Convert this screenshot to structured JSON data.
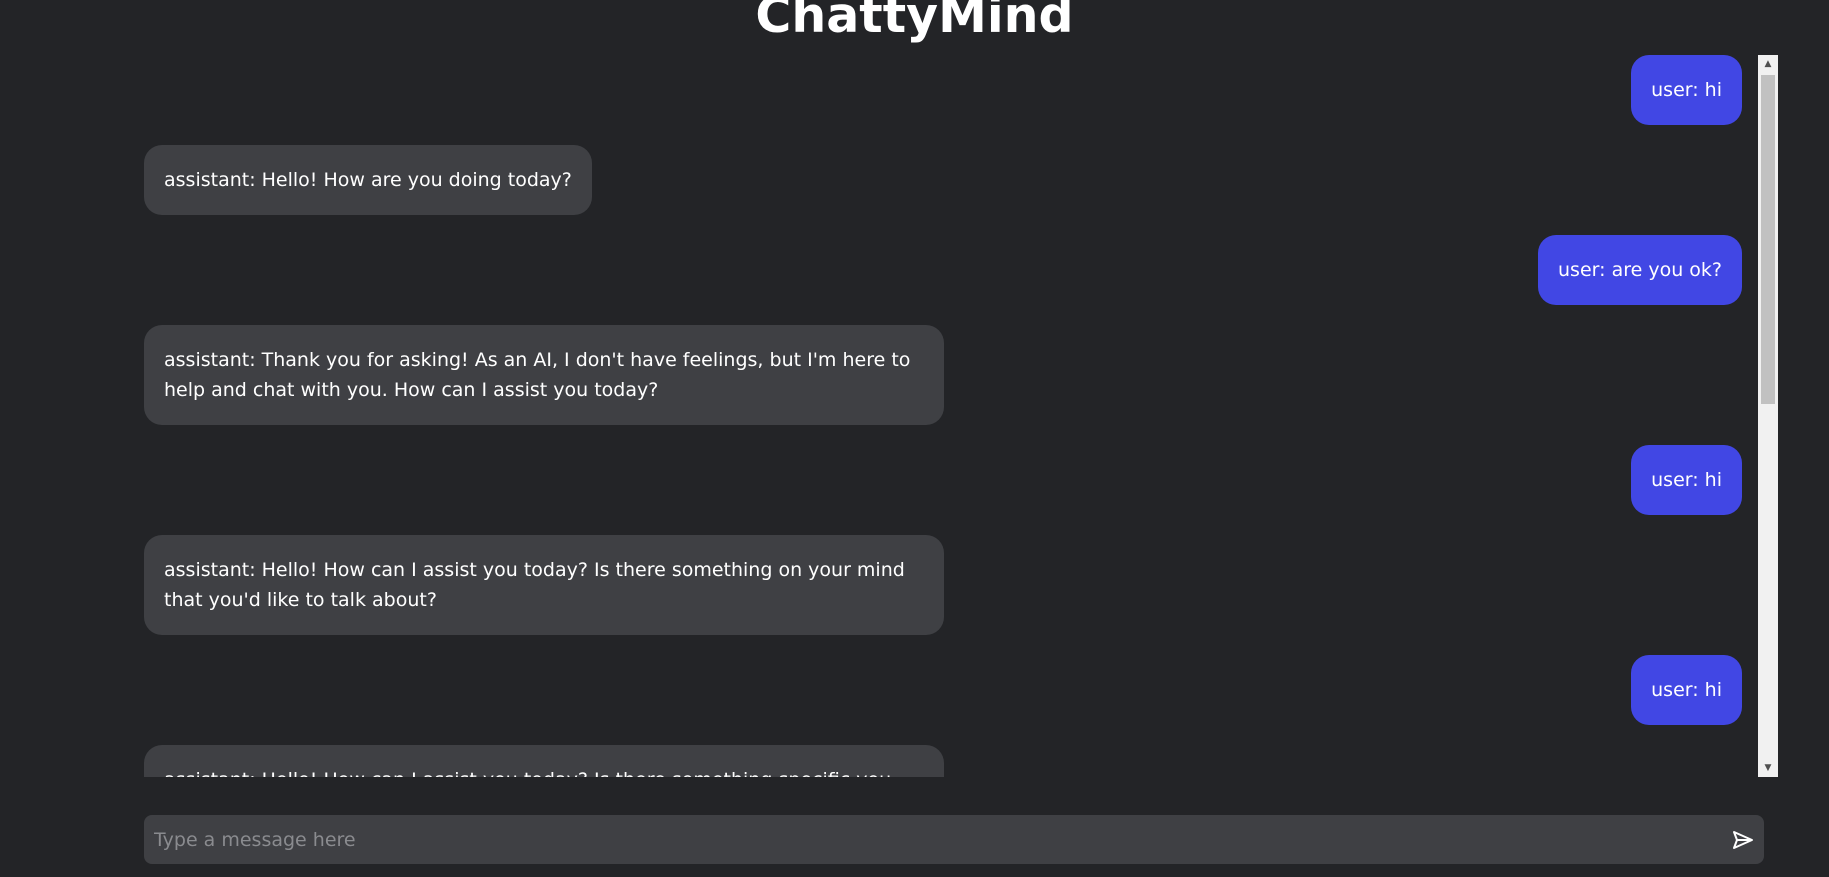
{
  "app": {
    "title": "ChattyMind"
  },
  "messages": [
    {
      "role": "user",
      "text": "user: hi"
    },
    {
      "role": "assistant",
      "text": "assistant: Hello! How are you doing today?"
    },
    {
      "role": "user",
      "text": "user: are you ok?"
    },
    {
      "role": "assistant",
      "text": "assistant: Thank you for asking! As an AI, I don't have feelings, but I'm here to help and chat with you. How can I assist you today?"
    },
    {
      "role": "user",
      "text": "user: hi"
    },
    {
      "role": "assistant",
      "text": "assistant: Hello! How can I assist you today? Is there something on your mind that you'd like to talk about?"
    },
    {
      "role": "user",
      "text": "user: hi"
    },
    {
      "role": "assistant",
      "text": "assistant: Hello! How can I assist you today? Is there something specific you would"
    }
  ],
  "input": {
    "placeholder": "Type a message here",
    "value": ""
  },
  "icons": {
    "send": "send-icon",
    "scroll_up": "scroll-up-arrow-icon",
    "scroll_down": "scroll-down-arrow-icon"
  },
  "colors": {
    "background": "#232427",
    "user_bubble": "#4147e4",
    "assistant_bubble": "#3f4044",
    "input_background": "#3f4044",
    "text": "#ffffff",
    "placeholder": "#8a8b8f"
  }
}
